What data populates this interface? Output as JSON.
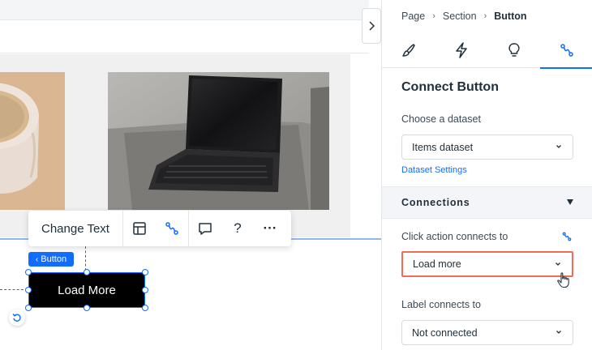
{
  "canvas": {
    "floating_toolbar": {
      "change_text_label": "Change Text",
      "layout_icon": "layout-icon",
      "connect_icon": "connect-data-icon",
      "comment_icon": "comment-icon",
      "help_label": "?",
      "more_label": "···"
    },
    "button_tag": {
      "label": "Button"
    },
    "button_element": {
      "label": "Load More"
    }
  },
  "panel": {
    "breadcrumb": [
      "Page",
      "Section",
      "Button"
    ],
    "tabs": [
      {
        "name": "design",
        "icon": "paintbrush-icon"
      },
      {
        "name": "animation",
        "icon": "lightning-icon"
      },
      {
        "name": "help",
        "icon": "lightbulb-icon"
      },
      {
        "name": "connect",
        "icon": "connect-data-icon",
        "active": true
      }
    ],
    "title": "Connect Button",
    "dataset_label": "Choose a dataset",
    "dataset_value": "Items dataset",
    "dataset_settings_link": "Dataset Settings",
    "connections_header": "Connections",
    "click_action_label": "Click action connects to",
    "click_action_value": "Load more",
    "label_connects_label": "Label connects to",
    "label_connects_value": "Not connected"
  },
  "colors": {
    "accent": "#116dff",
    "highlight": "#ef6c56",
    "button_bg": "#000000"
  }
}
